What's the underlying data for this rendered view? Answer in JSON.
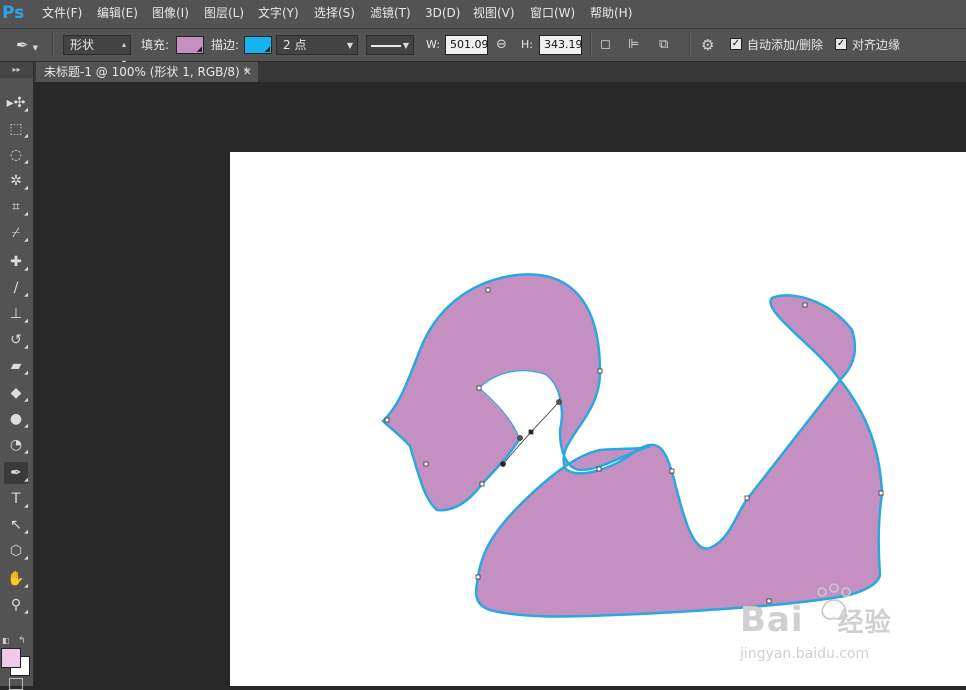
{
  "app": {
    "logo": "Ps"
  },
  "menu": [
    {
      "label": "文件(F)"
    },
    {
      "label": "编辑(E)"
    },
    {
      "label": "图像(I)"
    },
    {
      "label": "图层(L)"
    },
    {
      "label": "文字(Y)"
    },
    {
      "label": "选择(S)"
    },
    {
      "label": "滤镜(T)"
    },
    {
      "label": "3D(D)"
    },
    {
      "label": "视图(V)"
    },
    {
      "label": "窗口(W)"
    },
    {
      "label": "帮助(H)"
    }
  ],
  "options": {
    "mode": "形状",
    "fill_label": "填充:",
    "fill_color": "#c490c2",
    "stroke_label": "描边:",
    "stroke_color": "#15b4ef",
    "stroke_width": "2 点",
    "w_label": "W:",
    "w_value": "501.09",
    "h_label": "H:",
    "h_value": "343.19",
    "auto_add_delete": "自动添加/删除",
    "auto_add_delete_checked": true,
    "align_edges": "对齐边缘",
    "align_edges_checked": true
  },
  "document": {
    "tab_title": "未标题-1 @ 100% (形状 1, RGB/8) *",
    "close": "×",
    "shape_fill": "#c490c2",
    "shape_stroke": "#29a8dd"
  },
  "tools": [
    {
      "name": "move-icon",
      "glyph": "▸✣"
    },
    {
      "name": "marquee-icon",
      "glyph": "⬚"
    },
    {
      "name": "lasso-icon",
      "glyph": "◌"
    },
    {
      "name": "magic-wand-icon",
      "glyph": "✲"
    },
    {
      "name": "crop-icon",
      "glyph": "⌗"
    },
    {
      "name": "eyedropper-icon",
      "glyph": "⌿"
    },
    {
      "name": "healing-brush-icon",
      "glyph": "✚"
    },
    {
      "name": "brush-icon",
      "glyph": "∕"
    },
    {
      "name": "clone-stamp-icon",
      "glyph": "⊥"
    },
    {
      "name": "history-brush-icon",
      "glyph": "↺"
    },
    {
      "name": "eraser-icon",
      "glyph": "▰"
    },
    {
      "name": "paint-bucket-icon",
      "glyph": "◆"
    },
    {
      "name": "blur-icon",
      "glyph": "●"
    },
    {
      "name": "dodge-icon",
      "glyph": "◔"
    },
    {
      "name": "pen-icon",
      "glyph": "✒"
    },
    {
      "name": "type-icon",
      "glyph": "T"
    },
    {
      "name": "path-selection-icon",
      "glyph": "↖"
    },
    {
      "name": "shape-icon",
      "glyph": "⬡"
    },
    {
      "name": "hand-icon",
      "glyph": "✋"
    },
    {
      "name": "zoom-icon",
      "glyph": "⚲"
    }
  ],
  "colors": {
    "foreground": "#f0c8e8",
    "background": "#ffffff"
  },
  "watermark": {
    "brand_prefix": "Bai",
    "brand_suffix": "经验",
    "url": "jingyan.baidu.com"
  }
}
